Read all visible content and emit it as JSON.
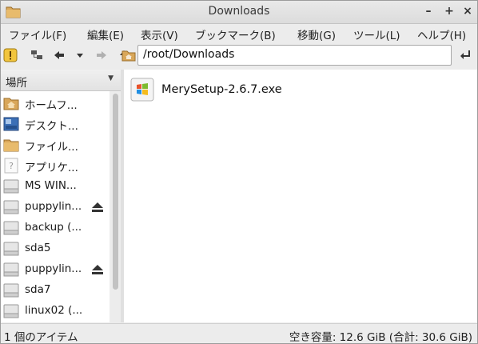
{
  "window": {
    "title": "Downloads",
    "minimize": "–",
    "maximize": "+",
    "close": "×"
  },
  "menu": [
    {
      "label": "ファイル(F)"
    },
    {
      "label": "編集(E)"
    },
    {
      "label": "表示(V)"
    },
    {
      "label": "ブックマーク(B)"
    },
    {
      "label": "移動(G)"
    },
    {
      "label": "ツール(L)"
    },
    {
      "label": "ヘルプ(H)"
    }
  ],
  "toolbar": {
    "address_value": "/root/Downloads",
    "icons": [
      "warning-icon",
      "network-icon",
      "back-icon",
      "history-dropdown-icon",
      "forward-icon",
      "up-icon",
      "folder-icon",
      "go-icon"
    ]
  },
  "sidebar": {
    "header": "場所",
    "items": [
      {
        "label": "ホームフ...",
        "icon": "home-folder-icon"
      },
      {
        "label": "デスクト...",
        "icon": "desktop-icon"
      },
      {
        "label": "ファイル...",
        "icon": "folder-icon"
      },
      {
        "label": "アプリケ...",
        "icon": "applications-icon"
      },
      {
        "label": "MS WIN...",
        "icon": "drive-icon"
      },
      {
        "label": "puppylin...",
        "icon": "drive-icon",
        "eject": true
      },
      {
        "label": "backup (...",
        "icon": "drive-icon"
      },
      {
        "label": "sda5",
        "icon": "drive-icon"
      },
      {
        "label": "puppylin...",
        "icon": "drive-icon",
        "eject": true
      },
      {
        "label": "sda7",
        "icon": "drive-icon"
      },
      {
        "label": "linux02 (...",
        "icon": "drive-icon"
      }
    ]
  },
  "files": [
    {
      "name": "MerySetup-2.6.7.exe",
      "icon": "windows-exe-icon"
    }
  ],
  "status": {
    "left": "1 個のアイテム",
    "right": "空き容量: 12.6 GiB (合計: 30.6 GiB)"
  }
}
